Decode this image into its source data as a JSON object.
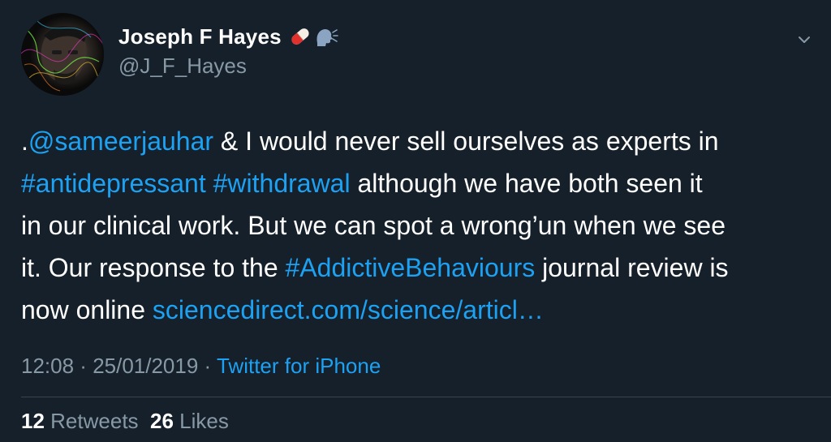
{
  "author": {
    "display_name": "Joseph F Hayes",
    "handle": "@J_F_Hayes",
    "emoji_icons": [
      "pill-icon",
      "speaking-head-icon"
    ]
  },
  "tweet": {
    "lines": [
      [
        {
          "text": ".",
          "kind": "text"
        },
        {
          "text": "@sameerjauhar",
          "kind": "link"
        },
        {
          "text": " & I would never sell ourselves as experts in",
          "kind": "text"
        }
      ],
      [
        {
          "text": "#antidepressant",
          "kind": "link"
        },
        {
          "text": " ",
          "kind": "text"
        },
        {
          "text": "#withdrawal",
          "kind": "link"
        },
        {
          "text": " although we have both seen it",
          "kind": "text"
        }
      ],
      [
        {
          "text": "in our clinical work. But we can spot a wrong’un when we see",
          "kind": "text"
        }
      ],
      [
        {
          "text": "it. Our response to the ",
          "kind": "text"
        },
        {
          "text": "#AddictiveBehaviours",
          "kind": "link"
        },
        {
          "text": " journal review is",
          "kind": "text"
        }
      ],
      [
        {
          "text": "now online ",
          "kind": "text"
        },
        {
          "text": "sciencedirect.com/science/articl…",
          "kind": "link"
        }
      ]
    ]
  },
  "meta": {
    "time": "12:08",
    "separator": " · ",
    "date": "25/01/2019",
    "source": "Twitter for iPhone"
  },
  "stats": {
    "retweets_count": "12",
    "retweets_label": "Retweets",
    "likes_count": "26",
    "likes_label": "Likes"
  },
  "colors": {
    "background": "#15202b",
    "link": "#1da1f2",
    "secondary_text": "#8899a6",
    "divider": "#38444d"
  }
}
